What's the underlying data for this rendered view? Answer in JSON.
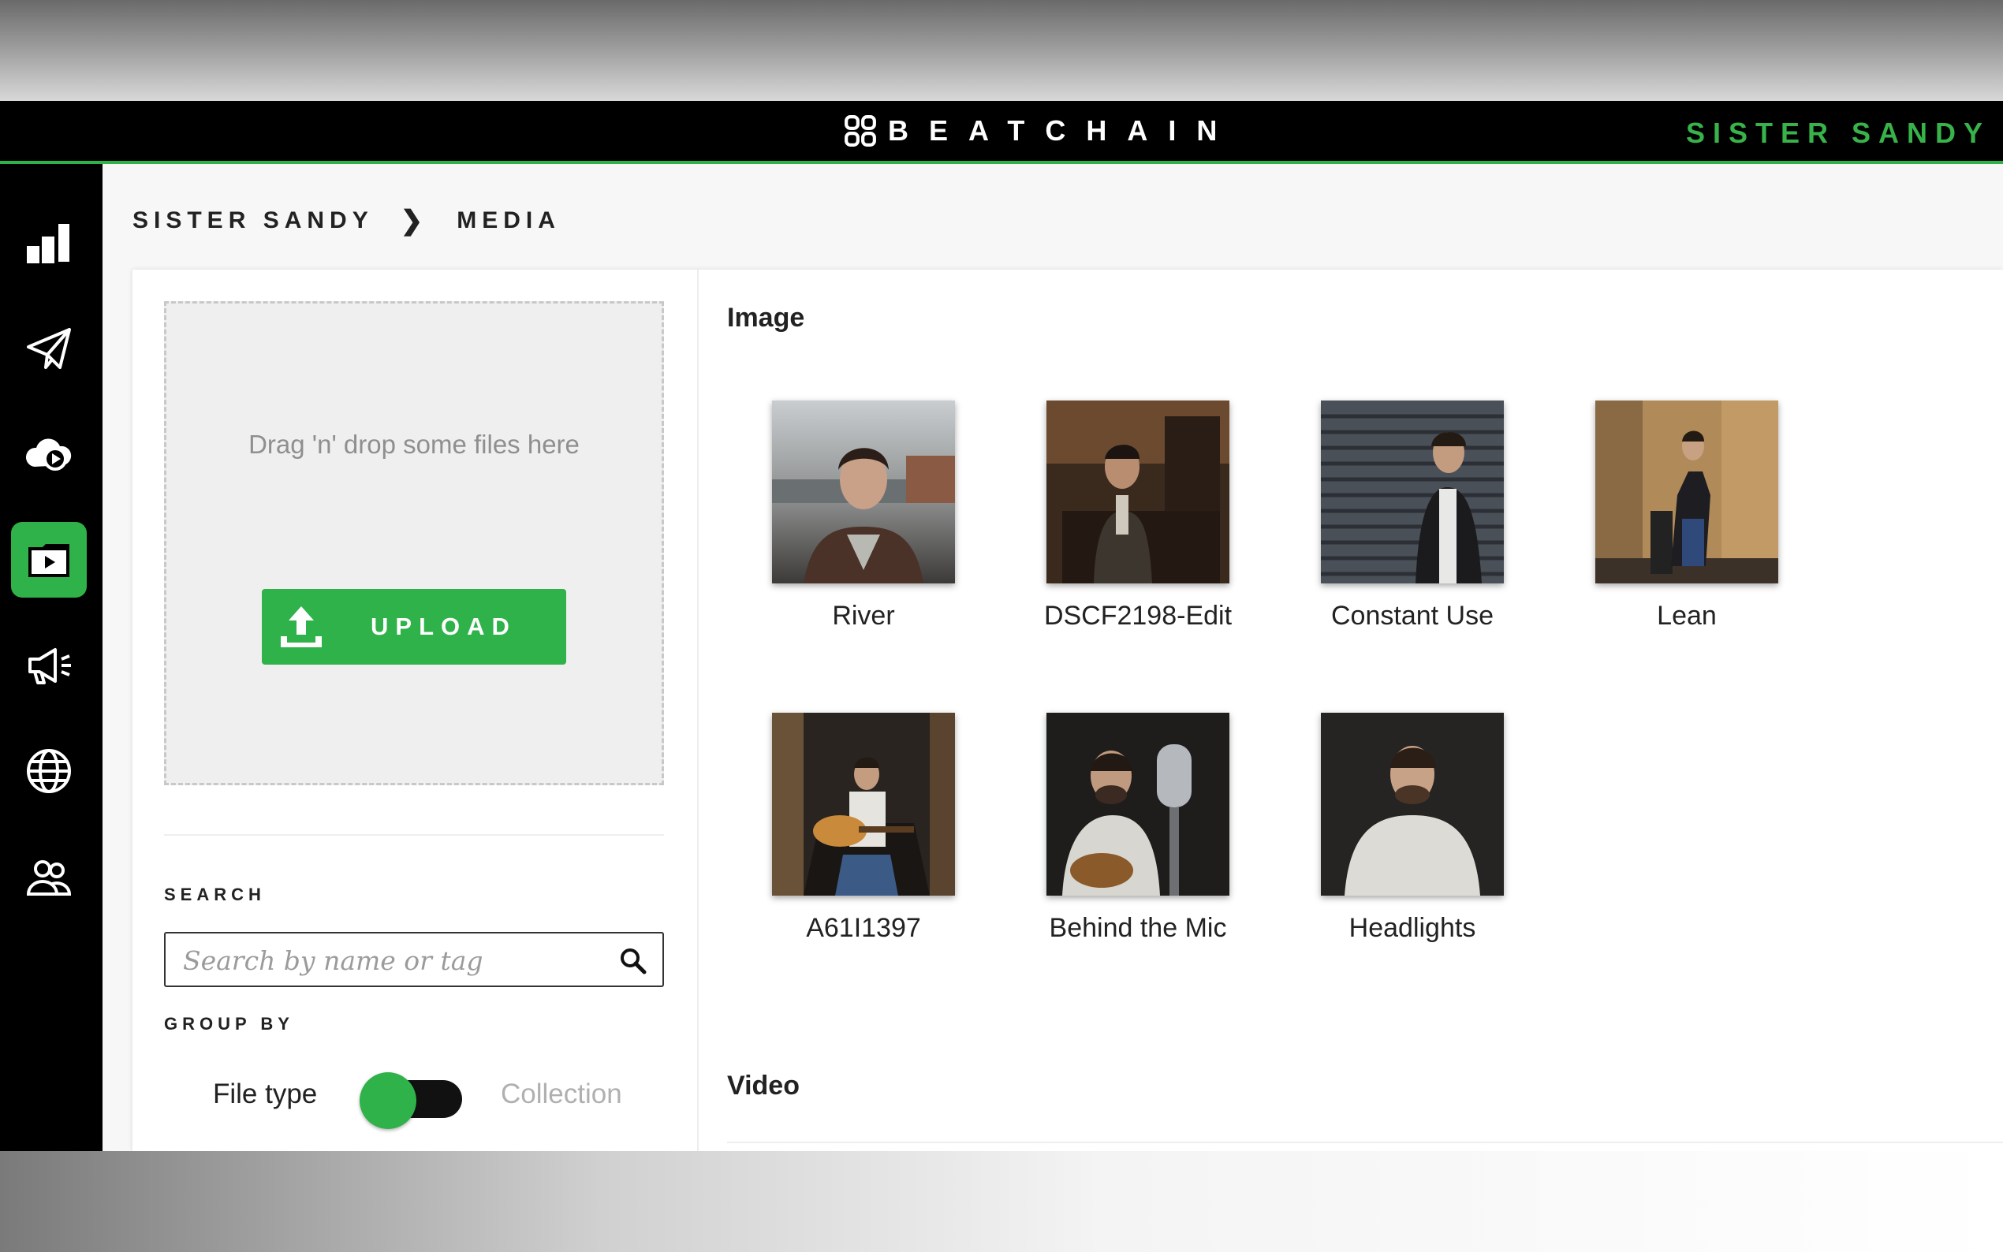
{
  "brand": {
    "name": "BEATCHAIN",
    "accent": "#2fb24a"
  },
  "header": {
    "artist": "SISTER SANDY"
  },
  "sidebar": {
    "items": [
      {
        "id": "analytics",
        "icon": "bar-chart-icon"
      },
      {
        "id": "send",
        "icon": "paper-plane-icon"
      },
      {
        "id": "cloud",
        "icon": "cloud-play-icon"
      },
      {
        "id": "media",
        "icon": "media-folder-icon",
        "active": true
      },
      {
        "id": "promote",
        "icon": "megaphone-icon"
      },
      {
        "id": "web",
        "icon": "globe-icon"
      },
      {
        "id": "team",
        "icon": "users-icon"
      }
    ]
  },
  "breadcrumb": {
    "root": "SISTER SANDY",
    "separator": "❯",
    "current": "MEDIA"
  },
  "upload": {
    "drop_text": "Drag 'n' drop some files here",
    "button_label": "UPLOAD"
  },
  "search": {
    "label": "SEARCH",
    "placeholder": "Search by name or tag",
    "value": ""
  },
  "group_by": {
    "label": "GROUP BY",
    "option_left": "File type",
    "option_right": "Collection",
    "selected": "File type"
  },
  "sections": {
    "image_title": "Image",
    "video_title": "Video"
  },
  "images": [
    {
      "name": "River"
    },
    {
      "name": "DSCF2198-Edit"
    },
    {
      "name": "Constant Use"
    },
    {
      "name": "Lean"
    },
    {
      "name": "A61I1397"
    },
    {
      "name": "Behind the Mic"
    },
    {
      "name": "Headlights"
    }
  ]
}
